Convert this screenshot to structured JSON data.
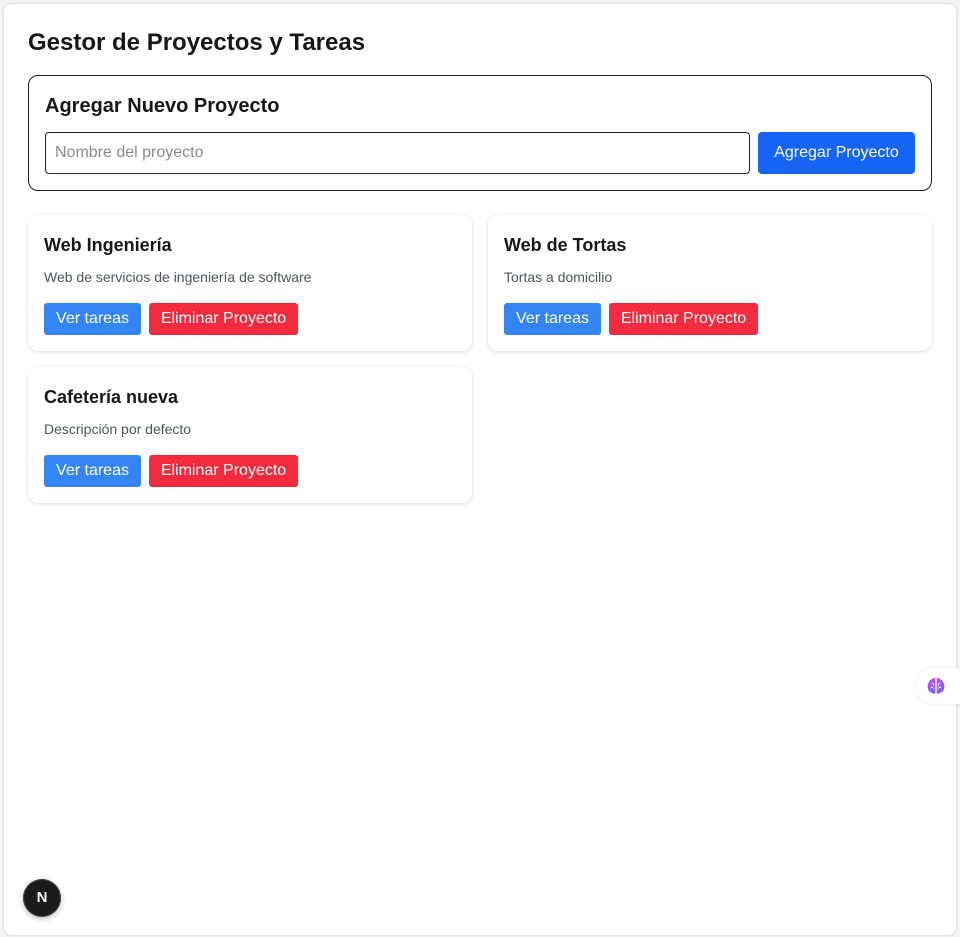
{
  "header": {
    "title": "Gestor de Proyectos y Tareas"
  },
  "add_project": {
    "title": "Agregar Nuevo Proyecto",
    "input_value": "",
    "input_placeholder": "Nombre del proyecto",
    "button_label": "Agregar Proyecto"
  },
  "projects": [
    {
      "name": "Web Ingeniería",
      "description": "Web de servicios de ingeniería de software",
      "tasks_label": "Ver tareas",
      "delete_label": "Eliminar Proyecto"
    },
    {
      "name": "Web de Tortas",
      "description": "Tortas a domicilio",
      "tasks_label": "Ver tareas",
      "delete_label": "Eliminar Proyecto"
    },
    {
      "name": "Cafetería nueva",
      "description": "Descripción por defecto",
      "tasks_label": "Ver tareas",
      "delete_label": "Eliminar Proyecto"
    }
  ],
  "overlays": {
    "extension_icon": "brain-icon",
    "dev_badge_letter": "N"
  },
  "colors": {
    "primary": "#1765f5",
    "tasks_button": "#3385f5",
    "danger": "#f42a3e"
  }
}
